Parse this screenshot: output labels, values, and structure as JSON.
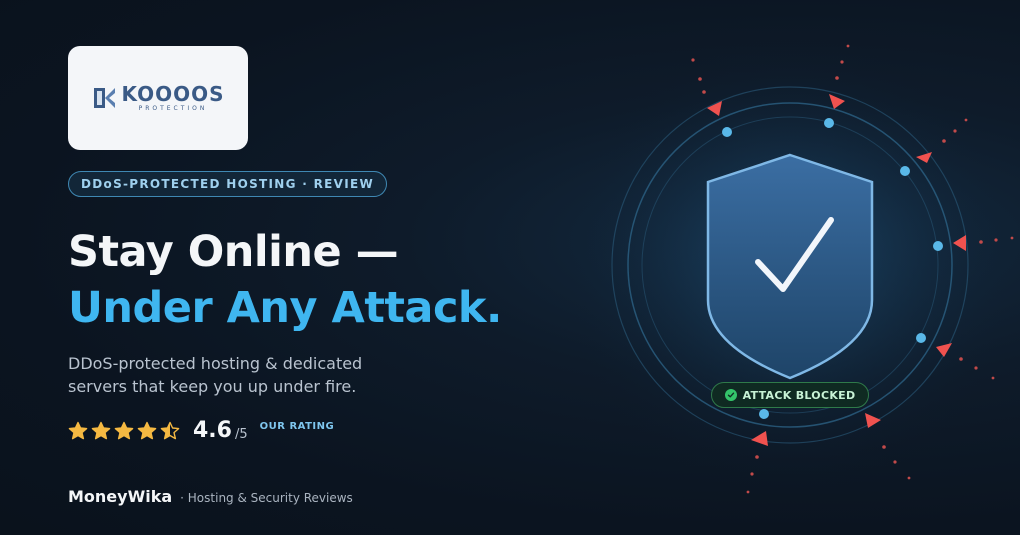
{
  "logo": {
    "word": "KOOOOS",
    "subline": "PROTECTION",
    "colors": {
      "primary": "#3a5a86",
      "card": "#f4f6f9"
    }
  },
  "tag": "DDoS-PROTECTED HOSTING · REVIEW",
  "headline": {
    "line1": "Stay Online —",
    "line2": "Under Any Attack."
  },
  "subtitle": "DDoS-protected hosting & dedicated servers that keep you up under fire.",
  "rating": {
    "stars": 4.5,
    "max_stars": 5,
    "score": "4.6",
    "out_of": "/5",
    "label": "OUR RATING"
  },
  "footer": {
    "brand": "MoneyWika",
    "description": "· Hosting & Security Reviews"
  },
  "badge": {
    "label": "ATTACK BLOCKED",
    "icon": "check-circle-icon"
  },
  "colors": {
    "background": "#0b1420",
    "accent": "#3fb6f0",
    "star": "#f5b942",
    "threat": "#f0524f",
    "safe": "#34c46a"
  },
  "icons": {
    "shield": "shield-check-icon",
    "attack": "triangle-arrow-icon",
    "node": "orbit-dot-icon"
  }
}
